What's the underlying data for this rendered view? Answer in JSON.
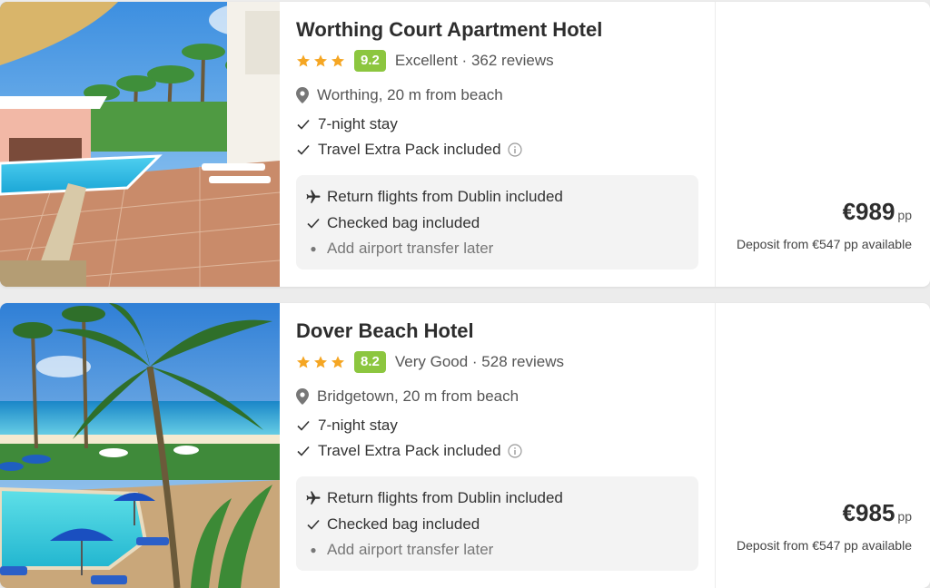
{
  "colors": {
    "star": "#f5a623",
    "score_badge": "#8cc63f",
    "page_background": "#ececec",
    "flight_box_background": "#f3f3f3"
  },
  "icons": {
    "star": "star-icon",
    "location": "map-pin-icon",
    "check": "check-icon",
    "info": "info-icon",
    "flight": "plane-icon",
    "bullet": "bullet-dot"
  },
  "hotels": [
    {
      "name": "Worthing Court Apartment Hotel",
      "stars": 3,
      "score": "9.2",
      "rating_label": "Excellent · 362 reviews",
      "location": "Worthing, 20 m from beach",
      "features": [
        "7-night stay",
        "Travel Extra Pack included"
      ],
      "flight_box": {
        "flights": "Return flights from Dublin included",
        "bag": "Checked bag included",
        "transfer": "Add airport transfer later"
      },
      "price": "€989",
      "price_unit": "pp",
      "deposit": "Deposit from €547 pp available"
    },
    {
      "name": "Dover Beach Hotel",
      "stars": 3,
      "score": "8.2",
      "rating_label": "Very Good · 528 reviews",
      "location": "Bridgetown, 20 m from beach",
      "features": [
        "7-night stay",
        "Travel Extra Pack included"
      ],
      "flight_box": {
        "flights": "Return flights from Dublin included",
        "bag": "Checked bag included",
        "transfer": "Add airport transfer later"
      },
      "price": "€985",
      "price_unit": "pp",
      "deposit": "Deposit from €547 pp available"
    }
  ]
}
